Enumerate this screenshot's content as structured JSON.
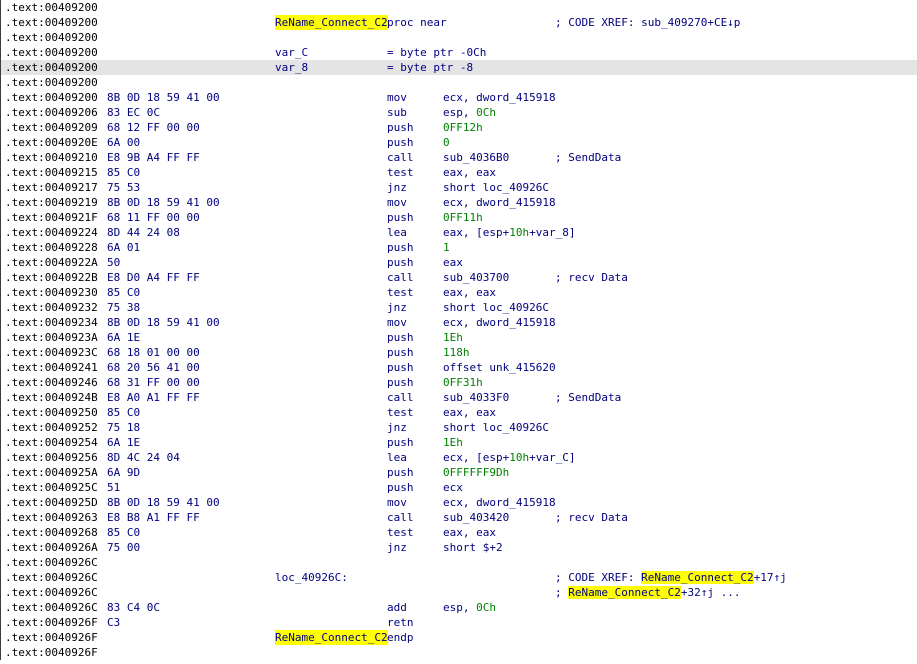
{
  "window": {
    "view": "IDA View - disassembly listing"
  },
  "lines": [
    {
      "addr": ".text:00409200"
    },
    {
      "addr": ".text:00409200",
      "label": "ReName_Connect_C2",
      "label_hl": true,
      "mn": "proc near",
      "comment": "; CODE XREF: sub_409270+CE↓p"
    },
    {
      "addr": ".text:00409200"
    },
    {
      "addr": ".text:00409200",
      "label": "var_C",
      "mn": "= byte ptr -0Ch"
    },
    {
      "addr": ".text:00409200",
      "label": "var_8",
      "mn": "= byte ptr -8",
      "highlight": true
    },
    {
      "addr": ".text:00409200"
    },
    {
      "addr": ".text:00409200",
      "bytes": "8B 0D 18 59 41 00",
      "mn": "mov",
      "op": "ecx, dword_415918"
    },
    {
      "addr": ".text:00409206",
      "bytes": "83 EC 0C",
      "mn": "sub",
      "op": "esp, ",
      "op_num": "0Ch"
    },
    {
      "addr": ".text:00409209",
      "bytes": "68 12 FF 00 00",
      "mn": "push",
      "op_num": "0FF12h"
    },
    {
      "addr": ".text:0040920E",
      "bytes": "6A 00",
      "mn": "push",
      "op_num": "0"
    },
    {
      "addr": ".text:00409210",
      "bytes": "E8 9B A4 FF FF",
      "mn": "call",
      "op": "sub_4036B0",
      "comment": "; SendData"
    },
    {
      "addr": ".text:00409215",
      "bytes": "85 C0",
      "mn": "test",
      "op": "eax, eax"
    },
    {
      "addr": ".text:00409217",
      "bytes": "75 53",
      "mn": "jnz",
      "op": "short loc_40926C"
    },
    {
      "addr": ".text:00409219",
      "bytes": "8B 0D 18 59 41 00",
      "mn": "mov",
      "op": "ecx, dword_415918"
    },
    {
      "addr": ".text:0040921F",
      "bytes": "68 11 FF 00 00",
      "mn": "push",
      "op_num": "0FF11h"
    },
    {
      "addr": ".text:00409224",
      "bytes": "8D 44 24 08",
      "mn": "lea",
      "op": "eax, [esp+",
      "op_num": "10h",
      "op_tail": "+var_8]"
    },
    {
      "addr": ".text:00409228",
      "bytes": "6A 01",
      "mn": "push",
      "op_num": "1"
    },
    {
      "addr": ".text:0040922A",
      "bytes": "50",
      "mn": "push",
      "op": "eax"
    },
    {
      "addr": ".text:0040922B",
      "bytes": "E8 D0 A4 FF FF",
      "mn": "call",
      "op": "sub_403700",
      "comment": "; recv Data"
    },
    {
      "addr": ".text:00409230",
      "bytes": "85 C0",
      "mn": "test",
      "op": "eax, eax"
    },
    {
      "addr": ".text:00409232",
      "bytes": "75 38",
      "mn": "jnz",
      "op": "short loc_40926C"
    },
    {
      "addr": ".text:00409234",
      "bytes": "8B 0D 18 59 41 00",
      "mn": "mov",
      "op": "ecx, dword_415918"
    },
    {
      "addr": ".text:0040923A",
      "bytes": "6A 1E",
      "mn": "push",
      "op_num": "1Eh"
    },
    {
      "addr": ".text:0040923C",
      "bytes": "68 18 01 00 00",
      "mn": "push",
      "op_num": "118h"
    },
    {
      "addr": ".text:00409241",
      "bytes": "68 20 56 41 00",
      "mn": "push",
      "op": "offset unk_415620"
    },
    {
      "addr": ".text:00409246",
      "bytes": "68 31 FF 00 00",
      "mn": "push",
      "op_num": "0FF31h"
    },
    {
      "addr": ".text:0040924B",
      "bytes": "E8 A0 A1 FF FF",
      "mn": "call",
      "op": "sub_4033F0",
      "comment": "; SendData"
    },
    {
      "addr": ".text:00409250",
      "bytes": "85 C0",
      "mn": "test",
      "op": "eax, eax"
    },
    {
      "addr": ".text:00409252",
      "bytes": "75 18",
      "mn": "jnz",
      "op": "short loc_40926C"
    },
    {
      "addr": ".text:00409254",
      "bytes": "6A 1E",
      "mn": "push",
      "op_num": "1Eh"
    },
    {
      "addr": ".text:00409256",
      "bytes": "8D 4C 24 04",
      "mn": "lea",
      "op": "ecx, [esp+",
      "op_num": "10h",
      "op_tail": "+var_C]"
    },
    {
      "addr": ".text:0040925A",
      "bytes": "6A 9D",
      "mn": "push",
      "op_num": "0FFFFFF9Dh"
    },
    {
      "addr": ".text:0040925C",
      "bytes": "51",
      "mn": "push",
      "op": "ecx"
    },
    {
      "addr": ".text:0040925D",
      "bytes": "8B 0D 18 59 41 00",
      "mn": "mov",
      "op": "ecx, dword_415918"
    },
    {
      "addr": ".text:00409263",
      "bytes": "E8 B8 A1 FF FF",
      "mn": "call",
      "op": "sub_403420",
      "comment": "; recv Data"
    },
    {
      "addr": ".text:00409268",
      "bytes": "85 C0",
      "mn": "test",
      "op": "eax, eax"
    },
    {
      "addr": ".text:0040926A",
      "bytes": "75 00",
      "mn": "jnz",
      "op": "short $+2"
    },
    {
      "addr": ".text:0040926C"
    },
    {
      "addr": ".text:0040926C",
      "label": "loc_40926C:",
      "comment": "; CODE XREF: ",
      "xref_hl": "ReName_Connect_C2",
      "xref_tail": "+17↑j"
    },
    {
      "addr": ".text:0040926C",
      "comment": "; ",
      "xref_hl": "ReName_Connect_C2",
      "xref_tail": "+32↑j ..."
    },
    {
      "addr": ".text:0040926C",
      "bytes": "83 C4 0C",
      "mn": "add",
      "op": "esp, ",
      "op_num": "0Ch"
    },
    {
      "addr": ".text:0040926F",
      "bytes": "C3",
      "mn": "retn"
    },
    {
      "addr": ".text:0040926F",
      "label": "ReName_Connect_C2",
      "label_hl": true,
      "mn": "endp"
    },
    {
      "addr": ".text:0040926F"
    }
  ],
  "colors": {
    "background": "#ffffff",
    "code": "#000080",
    "number": "#008000",
    "highlight_name": "#ffff00",
    "selected_line": "#e4e4e4"
  }
}
